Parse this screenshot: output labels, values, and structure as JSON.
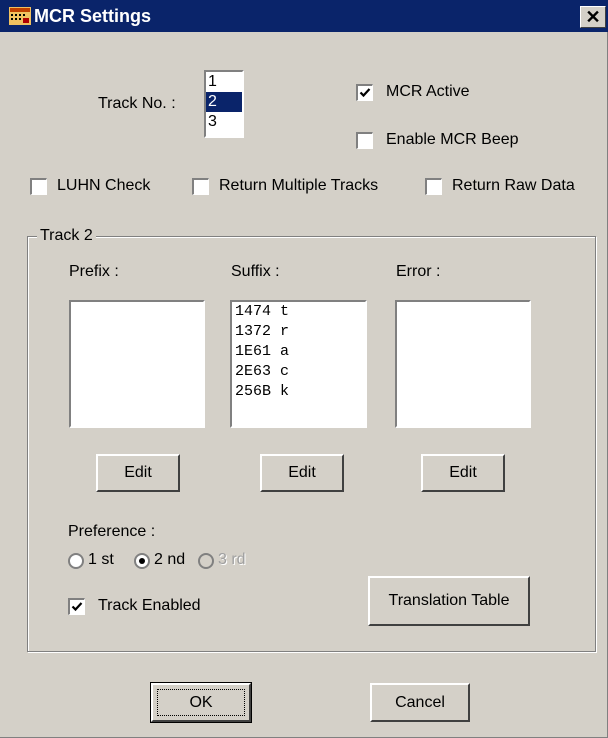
{
  "window": {
    "title": "MCR Settings",
    "close_symbol": "✕"
  },
  "track_no": {
    "label": "Track No. :",
    "items": [
      "1",
      "2",
      "3"
    ],
    "selected": "2"
  },
  "options": {
    "mcr_active": {
      "label": "MCR Active",
      "checked": true
    },
    "enable_beep": {
      "label": "Enable MCR Beep",
      "checked": false
    },
    "luhn_check": {
      "label": "LUHN Check",
      "checked": false
    },
    "return_multiple": {
      "label": "Return Multiple Tracks",
      "checked": false
    },
    "return_raw": {
      "label": "Return Raw Data",
      "checked": false
    }
  },
  "group": {
    "title": "Track 2",
    "prefix": {
      "label": "Prefix :",
      "items": [],
      "edit_label": "Edit"
    },
    "suffix": {
      "label": "Suffix :",
      "items": [
        "1474 t",
        "1372 r",
        "1E61 a",
        "2E63 c",
        "256B k"
      ],
      "edit_label": "Edit"
    },
    "error": {
      "label": "Error :",
      "items": [],
      "edit_label": "Edit"
    },
    "preference": {
      "label": "Preference :",
      "options": [
        {
          "label": "1 st",
          "selected": false,
          "enabled": true
        },
        {
          "label": "2 nd",
          "selected": true,
          "enabled": true
        },
        {
          "label": "3 rd",
          "selected": false,
          "enabled": false
        }
      ]
    },
    "track_enabled": {
      "label": "Track Enabled",
      "checked": true
    },
    "translation_table_label": "Translation Table"
  },
  "buttons": {
    "ok": "OK",
    "cancel": "Cancel"
  },
  "colors": {
    "titlebar": "#0a246a",
    "face": "#d4d0c8",
    "selection": "#0a246a"
  }
}
